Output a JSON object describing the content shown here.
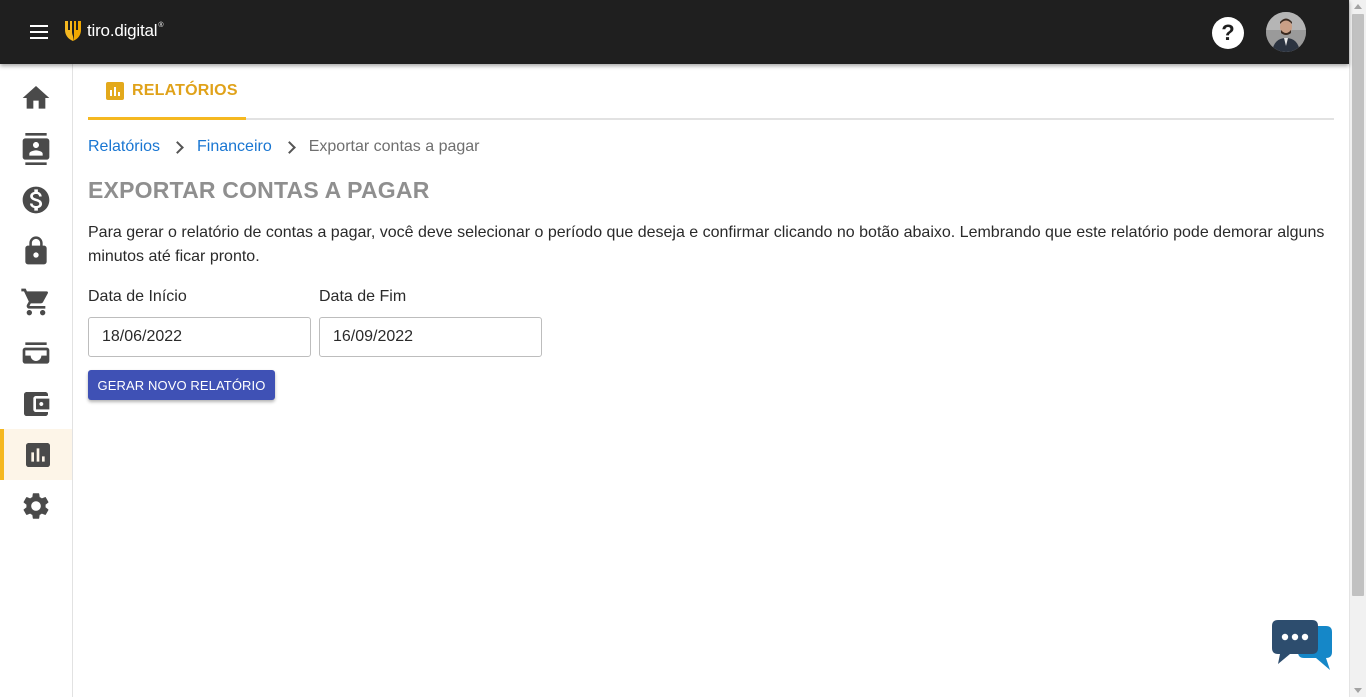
{
  "header": {
    "logo_text": "tiro.digital",
    "logo_reg": "®",
    "help_label": "?"
  },
  "sidebar": {
    "items": [
      {
        "icon": "home-icon"
      },
      {
        "icon": "contacts-icon"
      },
      {
        "icon": "dollar-icon"
      },
      {
        "icon": "lock-icon"
      },
      {
        "icon": "cart-icon"
      },
      {
        "icon": "inbox-icon"
      },
      {
        "icon": "wallet-icon"
      },
      {
        "icon": "chart-icon",
        "active": true
      },
      {
        "icon": "gear-icon"
      }
    ]
  },
  "tab": {
    "label": "RELATÓRIOS"
  },
  "breadcrumb": {
    "items": [
      "Relatórios",
      "Financeiro"
    ],
    "current": "Exportar contas a pagar"
  },
  "page": {
    "title": "EXPORTAR CONTAS A PAGAR",
    "description": "Para gerar o relatório de contas a pagar, você deve selecionar o período que deseja e confirmar clicando no botão abaixo. Lembrando que este relatório pode demorar alguns minutos até ficar pronto."
  },
  "form": {
    "start_label": "Data de Início",
    "start_value": "18/06/2022",
    "end_label": "Data de Fim",
    "end_value": "16/09/2022",
    "submit_label": "GERAR NOVO RELATÓRIO"
  },
  "colors": {
    "accent": "#f5b820",
    "primary_button": "#3f51b5",
    "link": "#1976d2",
    "topbar": "#1f1f1f"
  }
}
